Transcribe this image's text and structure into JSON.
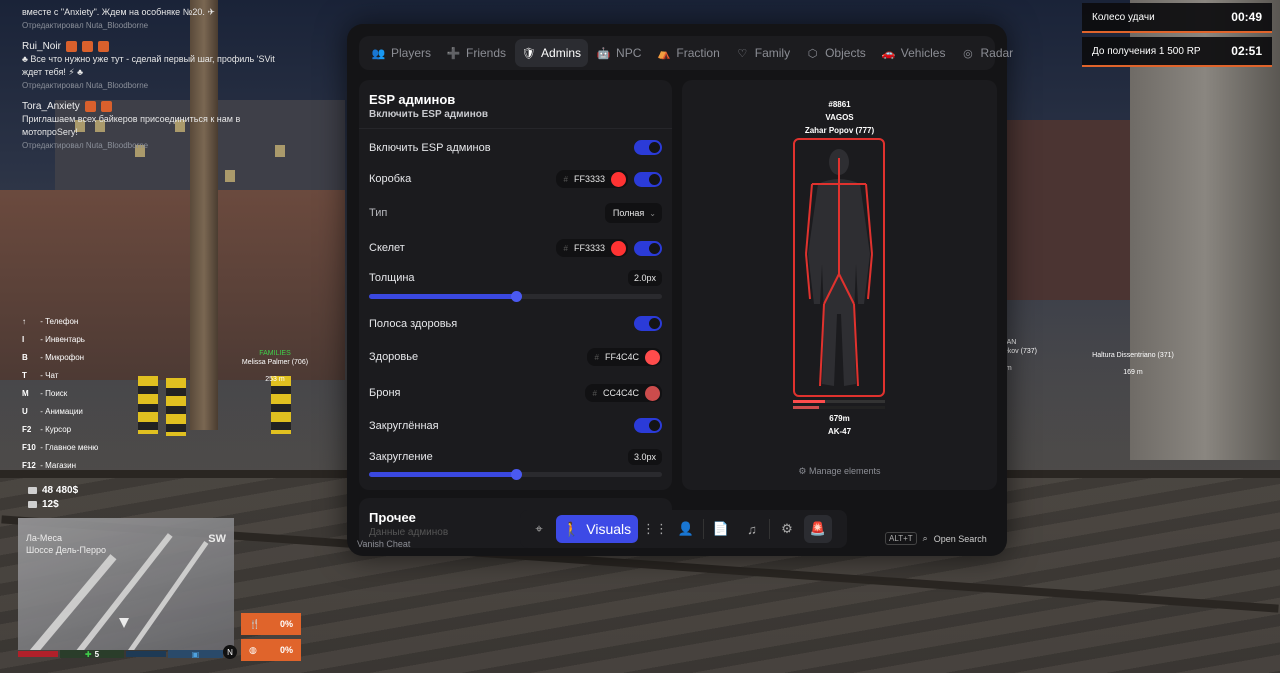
{
  "chat": {
    "lines": [
      {
        "type": "text",
        "text": "вместе с \"Anxiety\". Ждем на особняке №20. ✈"
      },
      {
        "type": "edit",
        "text": "Отредактировал Nuta_Bloodborne"
      },
      {
        "type": "author",
        "text": "Rui_Noir"
      },
      {
        "type": "text",
        "text": "♣ Все что нужно уже тут - сделай первый шаг, профиль 'SVit"
      },
      {
        "type": "text",
        "text": "ждет тебя! ⚡ ♣"
      },
      {
        "type": "edit",
        "text": "Отредактировал Nuta_Bloodborne"
      },
      {
        "type": "author",
        "text": "Tora_Anxiety"
      },
      {
        "type": "text",
        "text": "Приглашаем всех байкеров присоединиться к нам в"
      },
      {
        "type": "text",
        "text": "мотопроSery!"
      },
      {
        "type": "edit",
        "text": "Отредактировал Nuta_Bloodborne"
      }
    ]
  },
  "timers": [
    {
      "label": "Колесо удачи",
      "value": "00:49"
    },
    {
      "label": "До получения 1 500 RP",
      "value": "02:51"
    }
  ],
  "keybinds": [
    {
      "key": "↑",
      "label": "- Телефон"
    },
    {
      "key": "I",
      "label": "- Инвентарь"
    },
    {
      "key": "B",
      "label": "- Микрофон"
    },
    {
      "key": "T",
      "label": "- Чат"
    },
    {
      "key": "M",
      "label": "- Поиск"
    },
    {
      "key": "U",
      "label": "- Анимации"
    },
    {
      "key": "F2",
      "label": "- Курсор"
    },
    {
      "key": "F10",
      "label": "- Главное меню"
    },
    {
      "key": "F12",
      "label": "- Магазин"
    }
  ],
  "nametags": {
    "families": {
      "gang": "FAMILIES",
      "name": "Melissa Palmer (706)",
      "dist": "253 m"
    },
    "asian": {
      "gang": "SIAN",
      "name": "eekov (737)",
      "dist": "4 m"
    },
    "haltura": {
      "name": "Haltura Dissentriano (371)",
      "dist": "169 m"
    }
  },
  "hud": {
    "cash": "48 480$",
    "bank": "12$",
    "location": "Ла-Меса",
    "street": "Шоссе Дель-Перро",
    "direction": "SW",
    "compass": "N",
    "health_value": "5",
    "hunger": "0%",
    "thirst": "0%"
  },
  "tabs": [
    {
      "label": "Players",
      "icon": "players-icon",
      "glyph": "👥"
    },
    {
      "label": "Friends",
      "icon": "friends-icon",
      "glyph": "➕"
    },
    {
      "label": "Admins",
      "icon": "shield-icon",
      "glyph": "🛡"
    },
    {
      "label": "NPC",
      "icon": "robot-icon",
      "glyph": "🤖"
    },
    {
      "label": "Fraction",
      "icon": "fraction-icon",
      "glyph": "⛺"
    },
    {
      "label": "Family",
      "icon": "heart-icon",
      "glyph": "♡"
    },
    {
      "label": "Objects",
      "icon": "cube-icon",
      "glyph": "⬡"
    },
    {
      "label": "Vehicles",
      "icon": "car-icon",
      "glyph": "🚗"
    },
    {
      "label": "Radar",
      "icon": "compass-icon",
      "glyph": "◎"
    }
  ],
  "active_tab": "Admins",
  "esp": {
    "title": "ESP админов",
    "subtitle": "Включить ESP админов",
    "enable_label": "Включить ESP админов",
    "box_label": "Коробка",
    "box_color": "FF3333",
    "type_label": "Тип",
    "type_value": "Полная",
    "skeleton_label": "Скелет",
    "skeleton_color": "FF3333",
    "thickness_label": "Толщина",
    "thickness_value": "2.0px",
    "thickness_fraction": 0.5,
    "healthbar_label": "Полоса здоровья",
    "health_label": "Здоровье",
    "health_color": "FF4C4C",
    "armor_label": "Броня",
    "armor_color": "CC4C4C",
    "rounded_label": "Закруглённая",
    "rounding_label": "Закругление",
    "rounding_value": "3.0px",
    "rounding_fraction": 0.5
  },
  "colors": {
    "box_hex": "#FF3333",
    "skeleton_hex": "#FF3333",
    "health_hex": "#FF4C4C",
    "armor_hex": "#CC4C4C",
    "accent": "#3D4AE6"
  },
  "other": {
    "title": "Прочее",
    "subtitle": "Данные админов"
  },
  "brand": "Vanish Cheat",
  "preview": {
    "id": "#8861",
    "gang": "VAGOS",
    "name": "Zahar Popov (777)",
    "distance": "679m",
    "weapon": "AK-47",
    "health_fraction": 0.35,
    "manage_label": "Manage elements"
  },
  "dock": {
    "visuals_label": "Visuals",
    "search_key": "ALT+T",
    "search_label": "Open Search"
  }
}
